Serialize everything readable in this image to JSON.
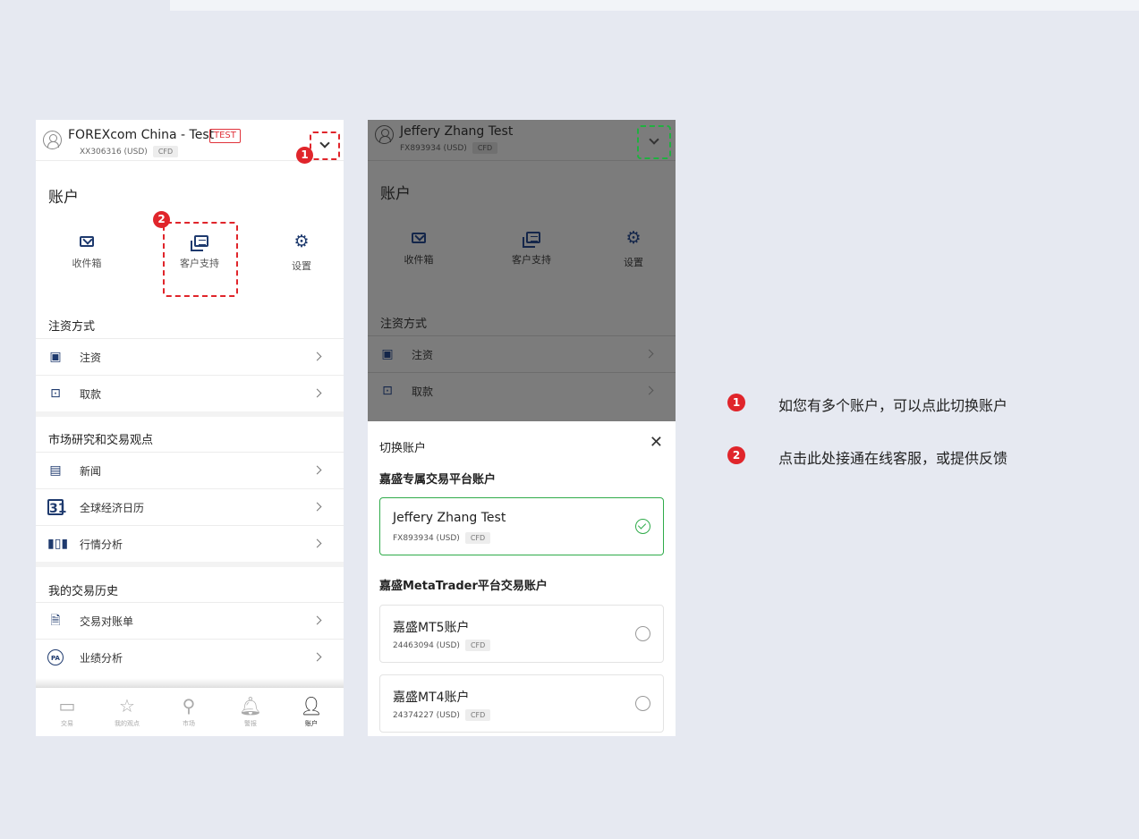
{
  "colors": {
    "accent_red": "#e0252b",
    "navy": "#1e3a6e",
    "green": "#2fab4a",
    "background": "#e6e9f1"
  },
  "phone1": {
    "account_name": "FOREXcom China - Test",
    "test_badge": "TEST",
    "account_number": "XX306316 (USD)",
    "cfd_badge": "CFD",
    "step1": "1",
    "step2": "2",
    "title": "账户",
    "quick": {
      "inbox": "收件箱",
      "support": "客户支持",
      "settings": "设置"
    },
    "sections": {
      "funding": "注资方式",
      "research": "市场研究和交易观点",
      "history": "我的交易历史"
    },
    "rows": {
      "deposit": "注资",
      "withdraw": "取款",
      "news": "新闻",
      "calendar": "全球经济日历",
      "calendar_icon_text": "31",
      "analysis": "行情分析",
      "statement": "交易对账单",
      "performance": "业绩分析",
      "performance_icon_text": "PA"
    },
    "nav": [
      "交易",
      "我的观点",
      "市场",
      "警报",
      "账户"
    ]
  },
  "phone2": {
    "account_name": "Jeffery Zhang Test",
    "account_number": "FX893934 (USD)",
    "cfd_badge": "CFD",
    "title": "账户",
    "quick": {
      "inbox": "收件箱",
      "support": "客户支持",
      "settings": "设置"
    },
    "section_funding": "注资方式",
    "rows": {
      "deposit": "注资",
      "withdraw": "取款"
    },
    "sheet": {
      "title": "切换账户",
      "group1": "嘉盛专属交易平台账户",
      "group2": "嘉盛MetaTrader平台交易账户",
      "accounts": [
        {
          "name": "Jeffery Zhang Test",
          "number": "FX893934 (USD)",
          "badge": "CFD"
        },
        {
          "name": "嘉盛MT5账户",
          "number": "24463094 (USD)",
          "badge": "CFD"
        },
        {
          "name": "嘉盛MT4账户",
          "number": "24374227 (USD)",
          "badge": "CFD"
        }
      ]
    }
  },
  "legend": [
    {
      "num": "1",
      "text": "如您有多个账户，可以点此切换账户"
    },
    {
      "num": "2",
      "text": "点击此处接通在线客服，或提供反馈"
    }
  ]
}
